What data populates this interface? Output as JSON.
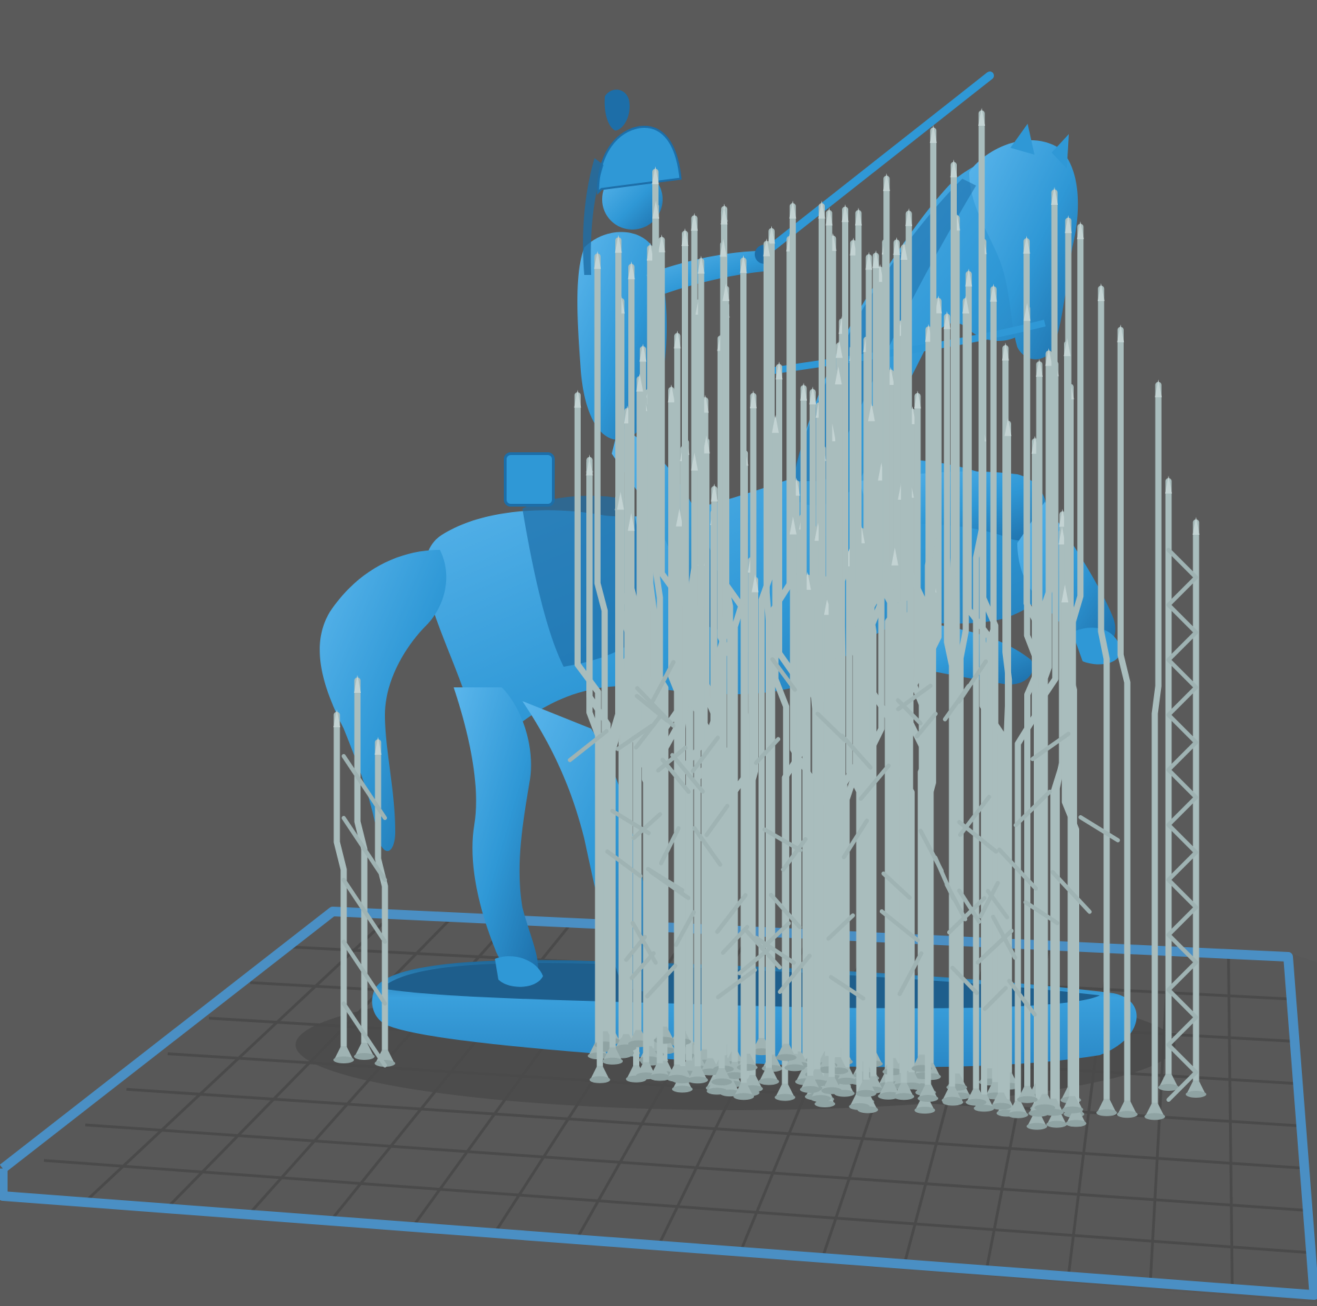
{
  "viewport": {
    "label": "",
    "background_color": "#5a5a5a",
    "build_plate": {
      "border_color": "#4a8fc4",
      "grid_color": "#4a4a4a",
      "fill_color": "#585858",
      "shadow_color": "#464646"
    },
    "model": {
      "description_name": "mounted-cuirassier-miniature",
      "body_color": "#2f98d6",
      "highlight_color": "#5bb6ec",
      "shade_color": "#1d6ea8",
      "base_color": "#2f8fd0"
    },
    "supports": {
      "color": "#a9bdbd",
      "dark_color": "#8fa3a3",
      "count_visible": 160
    }
  }
}
